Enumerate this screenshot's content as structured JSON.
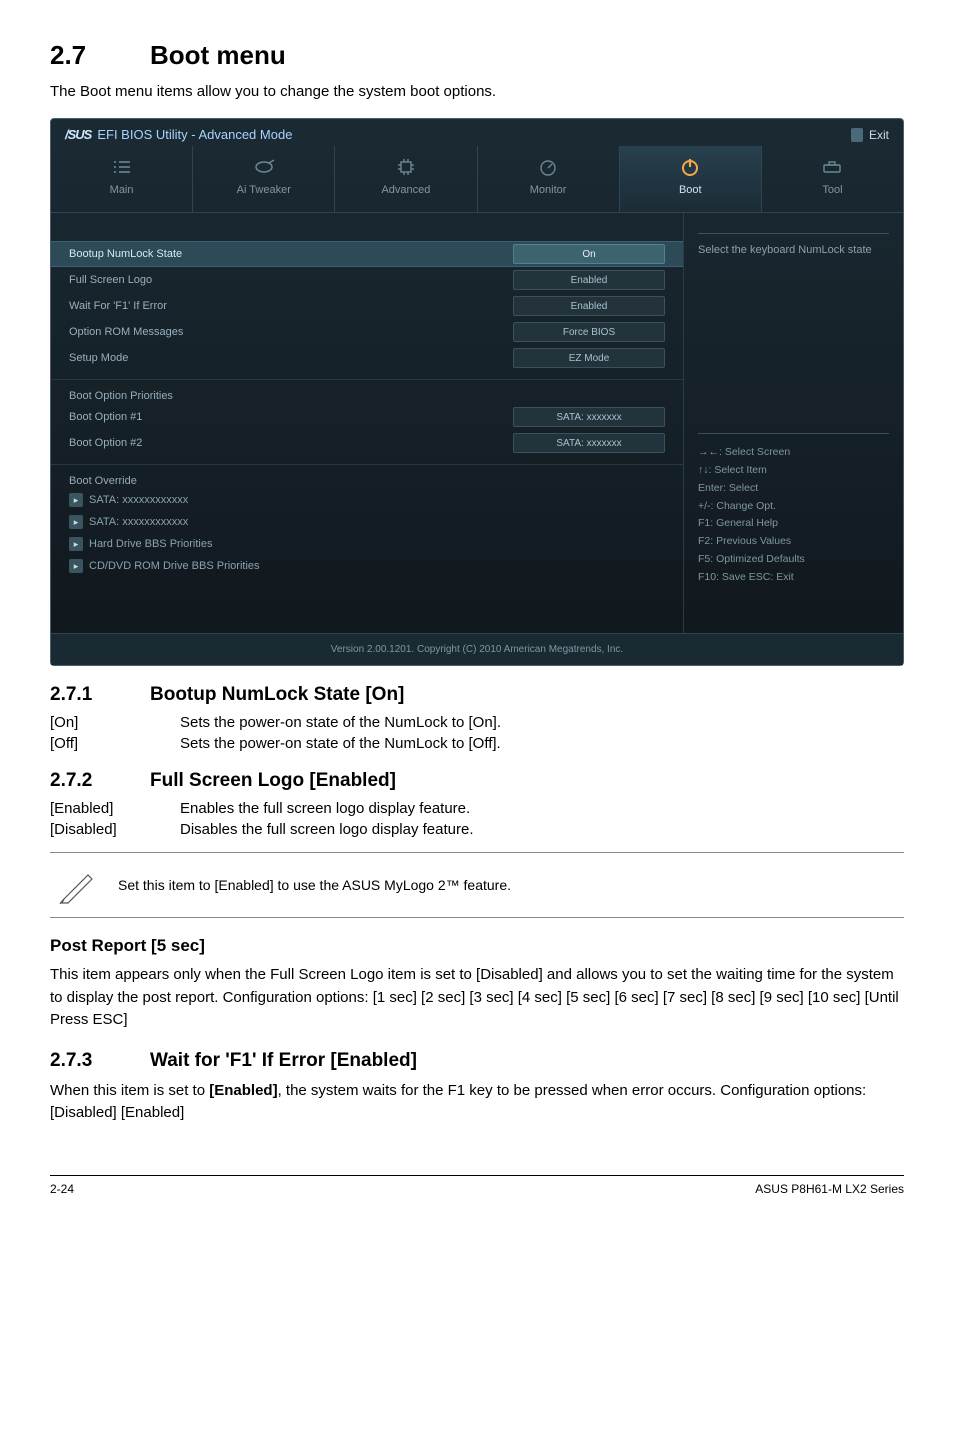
{
  "section": {
    "num": "2.7",
    "title": "Boot menu"
  },
  "intro": "The Boot menu items allow you to change the system boot options.",
  "bios": {
    "logo": "/SUS",
    "title": "EFI BIOS Utility - Advanced Mode",
    "exit": "Exit",
    "tabs": {
      "main": "Main",
      "tweaker": "Ai  Tweaker",
      "advanced": "Advanced",
      "monitor": "Monitor",
      "boot": "Boot",
      "tool": "Tool"
    },
    "rows": {
      "numlock": {
        "label": "Bootup NumLock State",
        "val": "On"
      },
      "fullscreen": {
        "label": "Full Screen Logo",
        "val": "Enabled"
      },
      "waitf1": {
        "label": "Wait For 'F1' If Error",
        "val": "Enabled"
      },
      "optrom": {
        "label": "Option ROM Messages",
        "val": "Force BIOS"
      },
      "setup": {
        "label": "Setup Mode",
        "val": "EZ Mode"
      }
    },
    "priorities": {
      "header": "Boot Option Priorities",
      "opt1": {
        "label": "Boot Option #1",
        "val": "SATA: xxxxxxx"
      },
      "opt2": {
        "label": "Boot Option #2",
        "val": "SATA: xxxxxxx"
      }
    },
    "override": {
      "header": "Boot Override",
      "sata1": "SATA: xxxxxxxxxxxx",
      "sata2": "SATA: xxxxxxxxxxxx",
      "hdd": "Hard Drive BBS Priorities",
      "cd": "CD/DVD ROM Drive BBS Priorities"
    },
    "help": "Select the keyboard NumLock state",
    "keys": {
      "k1": "→←:  Select Screen",
      "k2": "↑↓:  Select Item",
      "k3": "Enter:  Select",
      "k4": "+/-:  Change Opt.",
      "k5": "F1:  General Help",
      "k6": "F2:  Previous Values",
      "k7": "F5:  Optimized Defaults",
      "k8": "F10:  Save    ESC:  Exit"
    },
    "footer": "Version  2.00.1201.   Copyright  (C)  2010 American  Megatrends,  Inc."
  },
  "s271": {
    "num": "2.7.1",
    "title": "Bootup NumLock State [On]",
    "on_k": "[On]",
    "on_v": "Sets the power-on state of the NumLock to [On].",
    "off_k": "[Off]",
    "off_v": "Sets the power-on state of the NumLock to [Off]."
  },
  "s272": {
    "num": "2.7.2",
    "title": "Full Screen Logo [Enabled]",
    "en_k": "[Enabled]",
    "en_v": "Enables the full screen logo display feature.",
    "dis_k": "[Disabled]",
    "dis_v": "Disables the full screen logo display feature.",
    "note": "Set this item to [Enabled] to use the ASUS MyLogo 2™ feature."
  },
  "post": {
    "title": "Post Report [5 sec]",
    "p1": "This item appears only when the Full Screen Logo item is set to [Disabled] and allows you to set the waiting time for the system to display the post report. Configuration options: [1 sec] [2 sec] [3 sec] [4 sec] [5 sec] [6 sec] [7 sec] [8 sec] [9 sec] [10 sec] [Until Press ESC]"
  },
  "s273": {
    "num": "2.7.3",
    "title": "Wait for 'F1' If Error [Enabled]",
    "p1a": "When this item is set to ",
    "p1b": "[Enabled]",
    "p1c": ", the system waits for the F1 key to be pressed when error occurs. Configuration options: [Disabled] [Enabled]"
  },
  "footer": {
    "left": "2-24",
    "right": "ASUS P8H61-M LX2 Series"
  }
}
